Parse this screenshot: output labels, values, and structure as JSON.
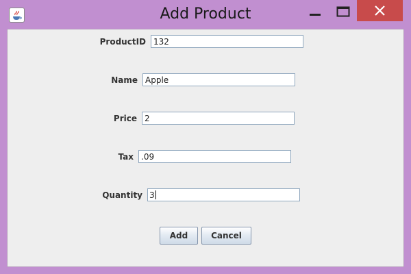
{
  "window": {
    "title": "Add Product",
    "close_glyph": "✕",
    "minimize_icon": "minimize-icon",
    "maximize_icon": "maximize-icon",
    "app_icon": "java-icon",
    "title_bar_color": "#c18fd0",
    "close_color": "#c84b4b"
  },
  "form": {
    "fields": [
      {
        "label": "ProductID",
        "value": "132"
      },
      {
        "label": "Name",
        "value": "Apple"
      },
      {
        "label": "Price",
        "value": "2"
      },
      {
        "label": "Tax",
        "value": ".09"
      },
      {
        "label": "Quantity",
        "value": "3"
      }
    ],
    "focused_field": "Quantity"
  },
  "buttons": {
    "add_label": "Add",
    "cancel_label": "Cancel"
  }
}
